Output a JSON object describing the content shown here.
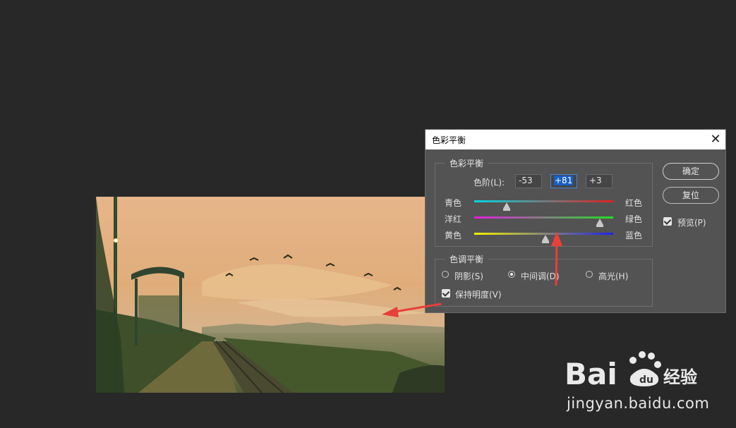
{
  "dialog": {
    "title": "色彩平衡",
    "close_glyph": "✕",
    "color_balance": {
      "group_label": "色彩平衡",
      "levels_label": "色阶(L):",
      "levels": [
        "-53",
        "+81",
        "+3"
      ],
      "sliders": [
        {
          "left": "青色",
          "right": "红色",
          "value": -53,
          "colors": [
            "#00d7e0",
            "#e02020"
          ]
        },
        {
          "left": "洋红",
          "right": "绿色",
          "value": 81,
          "colors": [
            "#e020e0",
            "#20e020"
          ]
        },
        {
          "left": "黄色",
          "right": "蓝色",
          "value": 3,
          "colors": [
            "#f0f000",
            "#2020f0"
          ]
        }
      ]
    },
    "tone_balance": {
      "group_label": "色调平衡",
      "options": [
        {
          "label": "阴影(S)",
          "selected": false
        },
        {
          "label": "中间调(D)",
          "selected": true
        },
        {
          "label": "高光(H)",
          "selected": false
        }
      ],
      "preserve_luminosity_label": "保持明度(V)",
      "preserve_luminosity_checked": true
    },
    "buttons": {
      "ok": "确定",
      "reset": "复位"
    },
    "preview_label": "预览(P)",
    "preview_checked": true
  },
  "watermark": {
    "url": "jingyan.baidu.com"
  },
  "colors": {
    "app_bg": "#282828",
    "dialog_bg": "#535353",
    "annotation_arrow": "#e8403a"
  }
}
